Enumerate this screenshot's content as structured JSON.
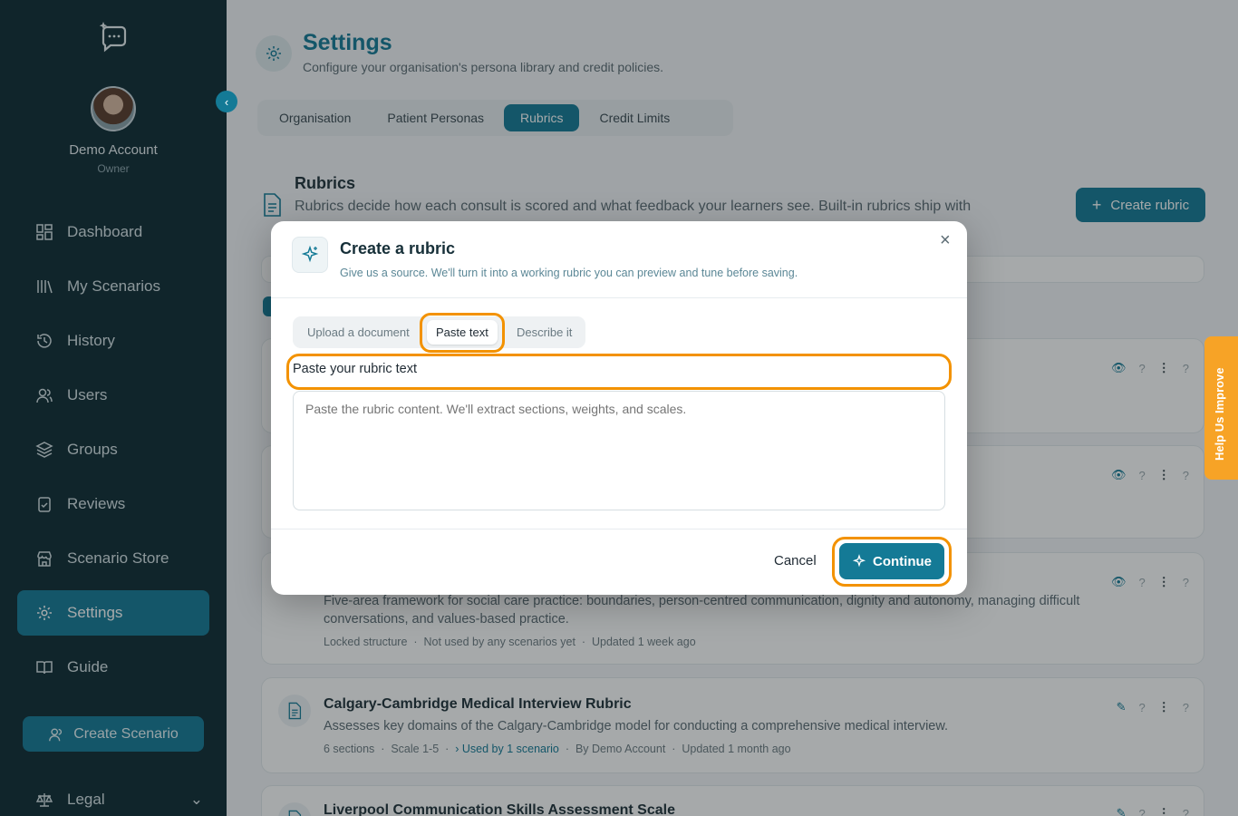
{
  "sidebar": {
    "account_name": "Demo Account",
    "account_role": "Owner",
    "nav": [
      {
        "label": "Dashboard",
        "icon": "dashboard-icon"
      },
      {
        "label": "My Scenarios",
        "icon": "library-icon"
      },
      {
        "label": "History",
        "icon": "history-icon"
      },
      {
        "label": "Users",
        "icon": "users-icon"
      },
      {
        "label": "Groups",
        "icon": "layers-icon"
      },
      {
        "label": "Reviews",
        "icon": "clipboard-icon"
      },
      {
        "label": "Scenario Store",
        "icon": "store-icon"
      },
      {
        "label": "Settings",
        "icon": "gear-icon",
        "active": true
      },
      {
        "label": "Guide",
        "icon": "book-icon"
      }
    ],
    "create_scenario_label": "Create Scenario",
    "legal_label": "Legal"
  },
  "header": {
    "title": "Settings",
    "subtitle": "Configure your organisation's persona library and credit policies.",
    "tabs": [
      "Organisation",
      "Patient Personas",
      "Rubrics",
      "Credit Limits"
    ],
    "active_tab": "Rubrics"
  },
  "rubrics": {
    "title": "Rubrics",
    "description": "Rubrics decide how each consult is scored and what feedback your learners see. Built-in rubrics ship with",
    "create_label": "Create rubric",
    "cards": [
      {
        "description": "Five-area framework for social care practice: boundaries, person-centred communication, dignity and autonomy, managing difficult conversations, and values-based practice.",
        "meta": [
          "Locked structure",
          "Not used by any scenarios yet",
          "Updated 1 week ago"
        ]
      },
      {
        "title": "Calgary-Cambridge Medical Interview Rubric",
        "description": "Assesses key domains of the Calgary-Cambridge model for conducting a comprehensive medical interview.",
        "meta_sections": "6 sections",
        "meta_scale": "Scale 1-5",
        "meta_used": "Used by 1 scenario",
        "meta_by": "By Demo Account",
        "meta_updated": "Updated 1 month ago"
      },
      {
        "title": "Liverpool Communication Skills Assessment Scale"
      }
    ]
  },
  "help_tab_label": "Help Us Improve",
  "modal": {
    "title": "Create a rubric",
    "subtitle": "Give us a source. We'll turn it into a working rubric you can preview and tune before saving.",
    "tabs": [
      "Upload a document",
      "Paste text",
      "Describe it"
    ],
    "active_tab": "Paste text",
    "field_label": "Paste your rubric text",
    "placeholder": "Paste the rubric content. We'll extract sections, weights, and scales.",
    "cancel_label": "Cancel",
    "continue_label": "Continue"
  },
  "colors": {
    "accent": "#147a96",
    "sidebar": "#0e2a33",
    "highlight": "#f39200",
    "help": "#f7a326"
  }
}
